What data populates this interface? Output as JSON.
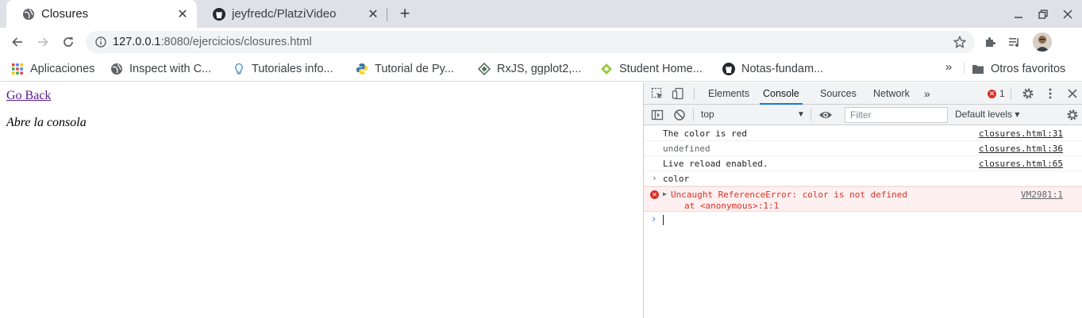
{
  "browser": {
    "tabs": [
      {
        "title": "Closures",
        "favicon": "globe-icon",
        "active": true
      },
      {
        "title": "jeyfredc/PlatziVideo",
        "favicon": "github-icon",
        "active": false
      }
    ],
    "address": {
      "host": "127.0.0.1",
      "rest": ":8080/ejercicios/closures.html"
    },
    "bookmarks": [
      {
        "label": "Aplicaciones",
        "icon": "apps-grid-icon"
      },
      {
        "label": "Inspect with C...",
        "icon": "globe-icon"
      },
      {
        "label": "Tutoriales info...",
        "icon": "bulb-icon"
      },
      {
        "label": "Tutorial de Py...",
        "icon": "python-icon"
      },
      {
        "label": "RxJS, ggplot2,...",
        "icon": "diamond-icon"
      },
      {
        "label": "Student Home...",
        "icon": "leaf-icon"
      },
      {
        "label": "Notas-fundam...",
        "icon": "github-icon"
      }
    ],
    "more_bookmarks": "»",
    "other_bookmarks": "Otros favoritos"
  },
  "page": {
    "link": "Go Back",
    "text": "Abre la consola"
  },
  "devtools": {
    "tabs": [
      "Elements",
      "Console",
      "Sources",
      "Network"
    ],
    "active_tab": "Console",
    "overflow": "»",
    "error_count": "1",
    "context": "top",
    "filter_placeholder": "Filter",
    "levels": "Default levels ▾",
    "console": [
      {
        "message": "The color is red",
        "source": "closures.html:31"
      },
      {
        "message": "undefined",
        "source": "closures.html:36"
      },
      {
        "message": "Live reload enabled.",
        "source": "closures.html:65"
      }
    ],
    "input_echo": "color",
    "error": {
      "message": "Uncaught ReferenceError: color is not defined",
      "stack": "at <anonymous>:1:1",
      "source": "VM2981:1"
    },
    "colors": {
      "error": "#d93025",
      "accent": "#1a73e8",
      "link": "#551a8b"
    }
  }
}
